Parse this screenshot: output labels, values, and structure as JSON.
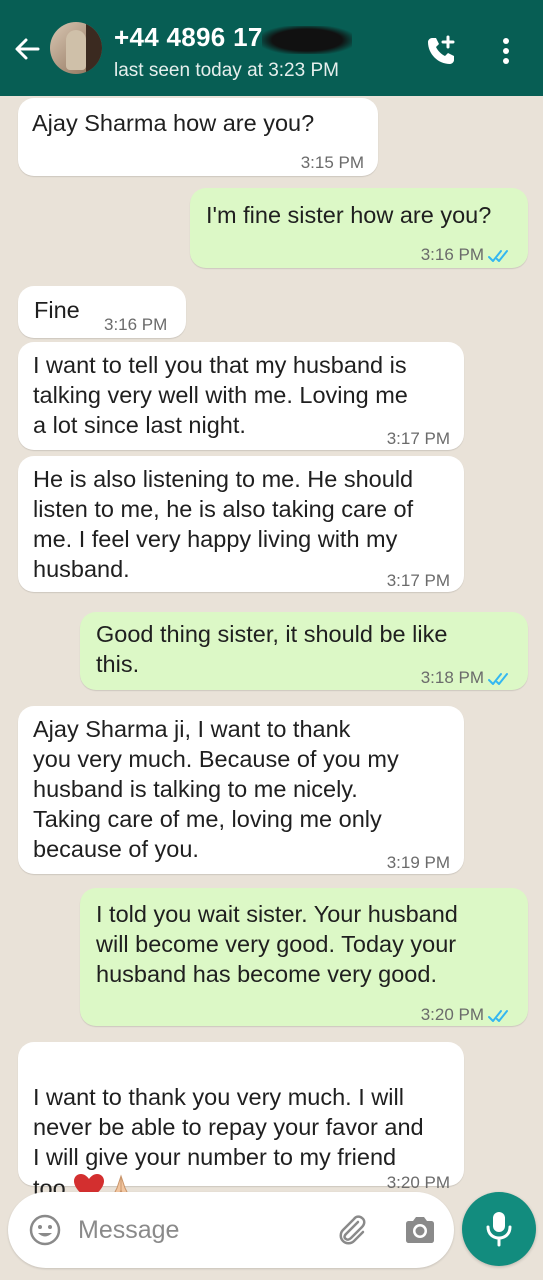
{
  "header": {
    "contact_name": "+44 4896 17",
    "status": "last seen today at 3:23 PM"
  },
  "messages": [
    {
      "direction": "in",
      "text": "Ajay Sharma how are you?",
      "time": "3:15 PM"
    },
    {
      "direction": "out",
      "text": "I'm fine sister how are you?",
      "time": "3:16 PM",
      "read": true
    },
    {
      "direction": "in",
      "text": "Fine",
      "time": "3:16 PM"
    },
    {
      "direction": "in",
      "text": "I want to tell you that my husband is\ntalking very well with me. Loving me\na lot since last night.",
      "time": "3:17 PM"
    },
    {
      "direction": "in",
      "text": "He is also listening to me. He should\nlisten to me, he is also taking care of\nme. I feel very happy living with my\nhusband.",
      "time": "3:17 PM"
    },
    {
      "direction": "out",
      "text": "Good thing sister, it should be like\nthis.",
      "time": "3:18 PM",
      "read": true
    },
    {
      "direction": "in",
      "text": "    Ajay Sharma ji, I want to thank\nyou very much. Because of you my\nhusband is talking to me nicely.\nTaking care of me, loving me only\nbecause of you.",
      "time": "3:19 PM"
    },
    {
      "direction": "out",
      "text": "I told you wait sister.  Your husband\nwill become very good.  Today your\nhusband has become very good.",
      "time": "3:20 PM",
      "read": true
    },
    {
      "direction": "in",
      "text": "I want to thank you very much. I will\nnever be able to repay your favor and\nI will give your number to my friend\ntoo.",
      "time": "3:20 PM",
      "emojis": [
        "red-heart",
        "folded-hands"
      ]
    }
  ],
  "composer": {
    "placeholder": "Message"
  },
  "colors": {
    "header": "#075e54",
    "outgoing_bubble": "#dcf8c6",
    "incoming_bubble": "#ffffff",
    "read_ticks": "#34b7f1",
    "mic_button": "#128c7e"
  }
}
